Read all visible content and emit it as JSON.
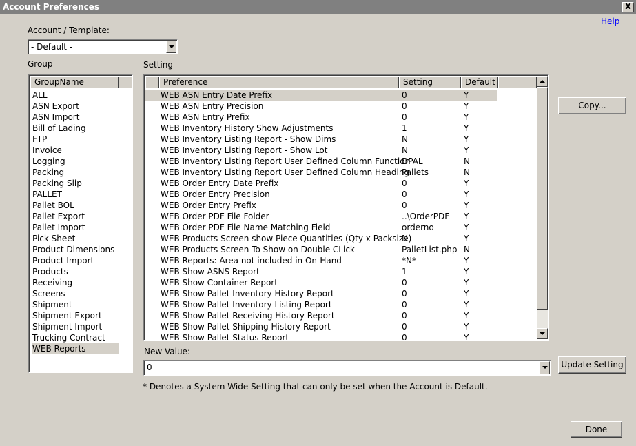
{
  "window": {
    "title": "Account Preferences",
    "close_label": "X"
  },
  "help_label": "Help",
  "account_template": {
    "label": "Account / Template:",
    "value": "- Default -"
  },
  "group": {
    "label": "Group",
    "column": "GroupName",
    "items": [
      "ALL",
      "ASN Export",
      "ASN Import",
      "Bill of Lading",
      "FTP",
      "Invoice",
      "Logging",
      "Packing",
      "Packing Slip",
      "PALLET",
      "Pallet BOL",
      "Pallet Export",
      "Pallet Import",
      "Pick Sheet",
      "Product Dimensions",
      "Product Import",
      "Products",
      "Receiving",
      "Screens",
      "Shipment",
      "Shipment Export",
      "Shipment Import",
      "Trucking Contract",
      "WEB Reports"
    ],
    "selected": "WEB Reports"
  },
  "setting": {
    "label": "Setting",
    "columns": [
      "Preference",
      "Setting",
      "Default"
    ],
    "rows": [
      [
        "WEB ASN Entry Date Prefix",
        "0",
        "Y"
      ],
      [
        "WEB ASN Entry Precision",
        "0",
        "Y"
      ],
      [
        "WEB ASN Entry Prefix",
        "0",
        "Y"
      ],
      [
        "WEB Inventory History Show Adjustments",
        "1",
        "Y"
      ],
      [
        "WEB Inventory Listing Report - Show Dims",
        "N",
        "Y"
      ],
      [
        "WEB Inventory Listing Report - Show Lot",
        "N",
        "Y"
      ],
      [
        "WEB Inventory Listing Report User Defined Column Function",
        "DPAL",
        "N"
      ],
      [
        "WEB Inventory Listing Report User Defined Column Heading",
        "Pallets",
        "N"
      ],
      [
        "WEB Order Entry Date Prefix",
        "0",
        "Y"
      ],
      [
        "WEB Order Entry Precision",
        "0",
        "Y"
      ],
      [
        "WEB Order Entry Prefix",
        "0",
        "Y"
      ],
      [
        "WEB Order PDF File Folder",
        "..\\OrderPDF",
        "Y"
      ],
      [
        "WEB Order PDF File Name Matching Field",
        "orderno",
        "Y"
      ],
      [
        "WEB Products Screen show Piece Quantities (Qty x Packsize)",
        "N",
        "Y"
      ],
      [
        "WEB Products Screen To Show on Double CLick",
        "PalletList.php",
        "N"
      ],
      [
        "WEB Reports: Area not included in On-Hand",
        "*N*",
        "Y"
      ],
      [
        "WEB Show ASNS Report",
        "1",
        "Y"
      ],
      [
        "WEB Show Container Report",
        "0",
        "Y"
      ],
      [
        "WEB Show Pallet Inventory History Report",
        "0",
        "Y"
      ],
      [
        "WEB Show Pallet Inventory Listing Report",
        "0",
        "Y"
      ],
      [
        "WEB Show Pallet Receiving History Report",
        "0",
        "Y"
      ],
      [
        "WEB Show Pallet Shipping History Report",
        "0",
        "Y"
      ],
      [
        "WEB Show Pallet Status Report",
        "0",
        "Y"
      ]
    ],
    "selected_row": 0
  },
  "buttons": {
    "copy": "Copy...",
    "update": "Update Setting",
    "done": "Done"
  },
  "new_value": {
    "label": "New Value:",
    "value": "0"
  },
  "footnote": "* Denotes a System Wide Setting that can only be set when the Account is Default."
}
